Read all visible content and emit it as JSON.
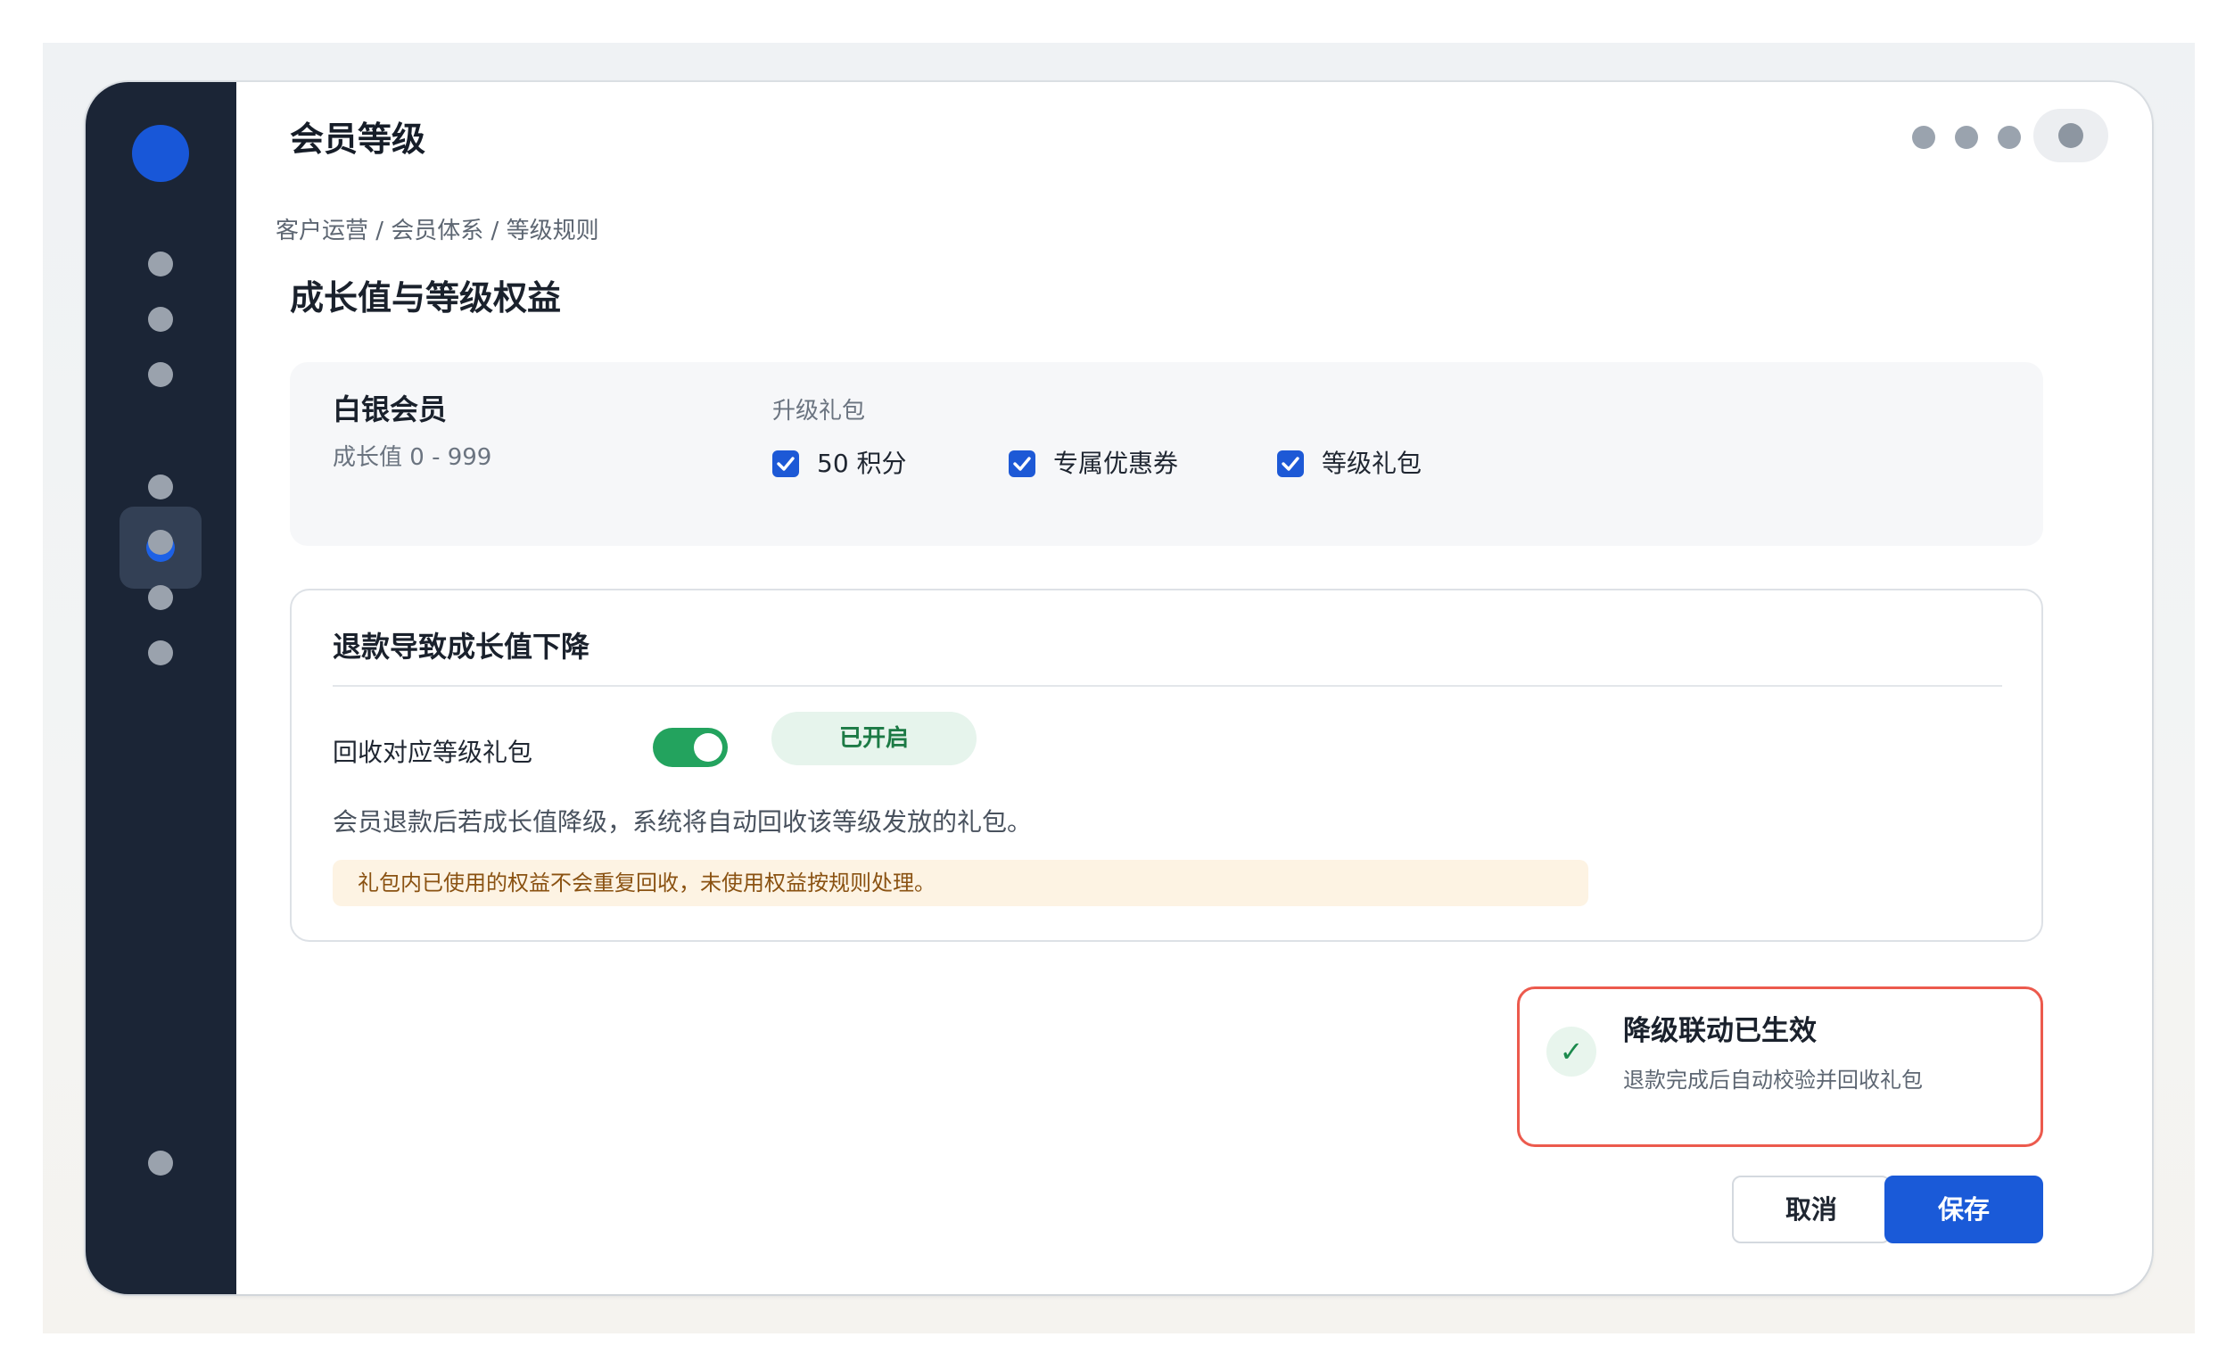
{
  "app": {
    "title": "会员等级"
  },
  "breadcrumb": {
    "text": "客户运营 / 会员体系 / 等级规则"
  },
  "page": {
    "title": "成长值与等级权益"
  },
  "level_card": {
    "name": "白银会员",
    "range": "成长值 0 - 999",
    "gift_label": "升级礼包",
    "gifts": [
      {
        "label": "50 积分",
        "checked": true
      },
      {
        "label": "专属优惠券",
        "checked": true
      },
      {
        "label": "等级礼包",
        "checked": true
      }
    ]
  },
  "refund_rule": {
    "title": "退款导致成长值下降",
    "option_label": "回收对应等级礼包",
    "toggle_on": true,
    "status": "已开启",
    "description": "会员退款后若成长值降级，系统将自动回收该等级发放的礼包。",
    "note": "礼包内已使用的权益不会重复回收，未使用权益按规则处理。"
  },
  "toast": {
    "icon": "check-icon",
    "title": "降级联动已生效",
    "description": "退款完成后自动校验并回收礼包"
  },
  "actions": {
    "cancel_label": "取消",
    "save_label": "保存"
  },
  "colors": {
    "sidebar": "#1b2536",
    "accent": "#1a5ad8",
    "success": "#23a35e",
    "toast_border": "#ec5a4d",
    "warning_bg": "#fdf3e3"
  }
}
